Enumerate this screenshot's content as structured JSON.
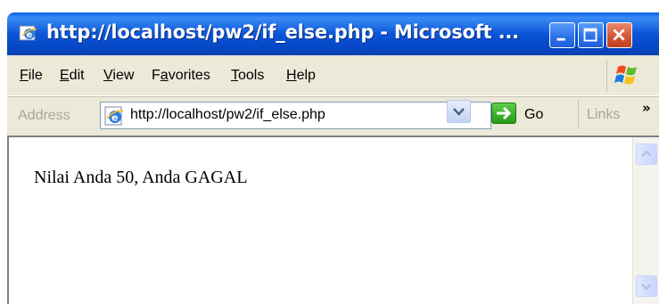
{
  "window": {
    "title": "http://localhost/pw2/if_else.php - Microsoft ...",
    "icon": "ie-page-icon",
    "controls": [
      "minimize-icon",
      "maximize-icon",
      "close-icon"
    ]
  },
  "menu": {
    "file": {
      "accel": "F",
      "rest": "ile"
    },
    "edit": {
      "accel": "E",
      "rest": "dit"
    },
    "view": {
      "accel": "V",
      "rest": "iew"
    },
    "favorites": {
      "pre": "F",
      "accel": "a",
      "rest": "vorites"
    },
    "tools": {
      "accel": "T",
      "rest": "ools"
    },
    "help": {
      "accel": "H",
      "rest": "elp"
    }
  },
  "addressbar": {
    "label": "Address",
    "url": "http://localhost/pw2/if_else.php",
    "go_label": "Go",
    "links_label": "Links",
    "links_more": "»"
  },
  "content": {
    "text": "Nilai Anda 50, Anda GAGAL"
  },
  "colors": {
    "titlebar": "#0b55d9",
    "chrome": "#ece9d8",
    "go_green": "#279a1a"
  }
}
